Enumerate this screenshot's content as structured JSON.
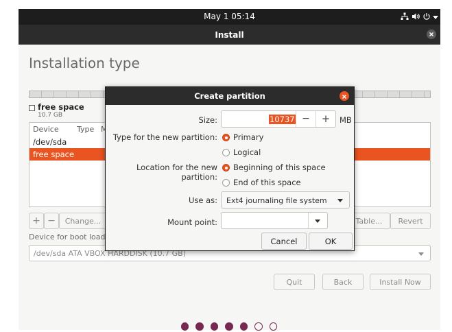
{
  "topbar": {
    "datetime": "May 1  05:14"
  },
  "window": {
    "title": "Install"
  },
  "installer": {
    "heading": "Installation type",
    "legend_label": "free space",
    "legend_size": "10.7 GB",
    "table": {
      "headers": [
        "Device",
        "Type",
        "M"
      ],
      "rows": [
        "/dev/sda",
        "free space"
      ]
    },
    "buttons": {
      "add": "+",
      "remove": "−",
      "change": "Change...",
      "new_table": "Table...",
      "revert": "Revert"
    },
    "boot_loader_label": "Device for boot loade",
    "boot_loader_value": "/dev/sda ATA VBOX HARDDISK (10.7 GB)",
    "nav": {
      "quit": "Quit",
      "back": "Back",
      "install_now": "Install Now"
    },
    "progress_total": 7,
    "progress_filled": 5
  },
  "dialog": {
    "title": "Create partition",
    "size_label": "Size:",
    "size_value": "10737",
    "size_unit": "MB",
    "minus": "−",
    "plus": "+",
    "type_label": "Type for the new partition:",
    "type_options": [
      "Primary",
      "Logical"
    ],
    "type_selected": "Primary",
    "location_label": "Location for the new partition:",
    "location_options": [
      "Beginning of this space",
      "End of this space"
    ],
    "location_selected": "Beginning of this space",
    "use_as_label": "Use as:",
    "use_as_value": "Ext4 journaling file system",
    "mount_label": "Mount point:",
    "mount_value": "",
    "cancel": "Cancel",
    "ok": "OK"
  },
  "colors": {
    "accent": "#e95420",
    "aubergine": "#772953",
    "topbar": "#1d1d1d",
    "titlebar": "#2c2c2c"
  }
}
